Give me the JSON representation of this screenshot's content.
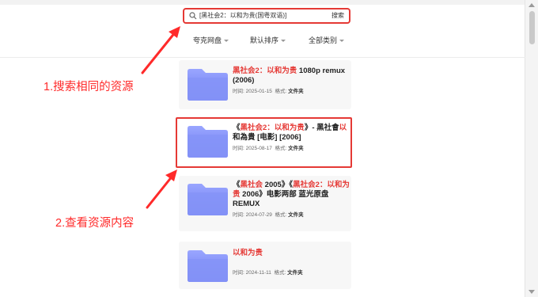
{
  "search": {
    "value": "[黑社会2：以和为贵(国粤双语)]",
    "button_label": "搜索"
  },
  "filters": [
    {
      "label": "夸克网盘"
    },
    {
      "label": "默认排序"
    },
    {
      "label": "全部类别"
    }
  ],
  "results": [
    {
      "title_red": "黑社会2：以和为贵",
      "title_rest": " 1080p remux (2006)",
      "time_label": "时间: ",
      "time": "2025-01-15",
      "format_label": "格式: ",
      "format": "文件夹"
    },
    {
      "title_open": "《",
      "title_red": "黑社会2：以和为贵",
      "title_mid": "》- 黑社會",
      "title_red2": "以",
      "title_rest": "和為貴 [电影] [2006]",
      "time_label": "时间: ",
      "time": "2025-08-17",
      "format_label": "格式: ",
      "format": "文件夹"
    },
    {
      "title_open": "《",
      "title_red": "黑社会",
      "title_mid": " 2005》《",
      "title_red2": "黑社会2：以和为贵",
      "title_rest": " 2006》电影两部 蓝光原盘REMUX",
      "time_label": "时间: ",
      "time": "2024-07-29",
      "format_label": "格式: ",
      "format": "文件夹"
    },
    {
      "title_red": "以和为贵",
      "time_label": "时间: ",
      "time": "2024-11-11",
      "format_label": "格式: ",
      "format": "文件夹"
    }
  ],
  "annotations": {
    "step1": "1.搜索相同的资源",
    "step2": "2.查看资源内容"
  },
  "colors": {
    "accent_red": "#e53935",
    "folder_blue": "#7f8df5"
  }
}
